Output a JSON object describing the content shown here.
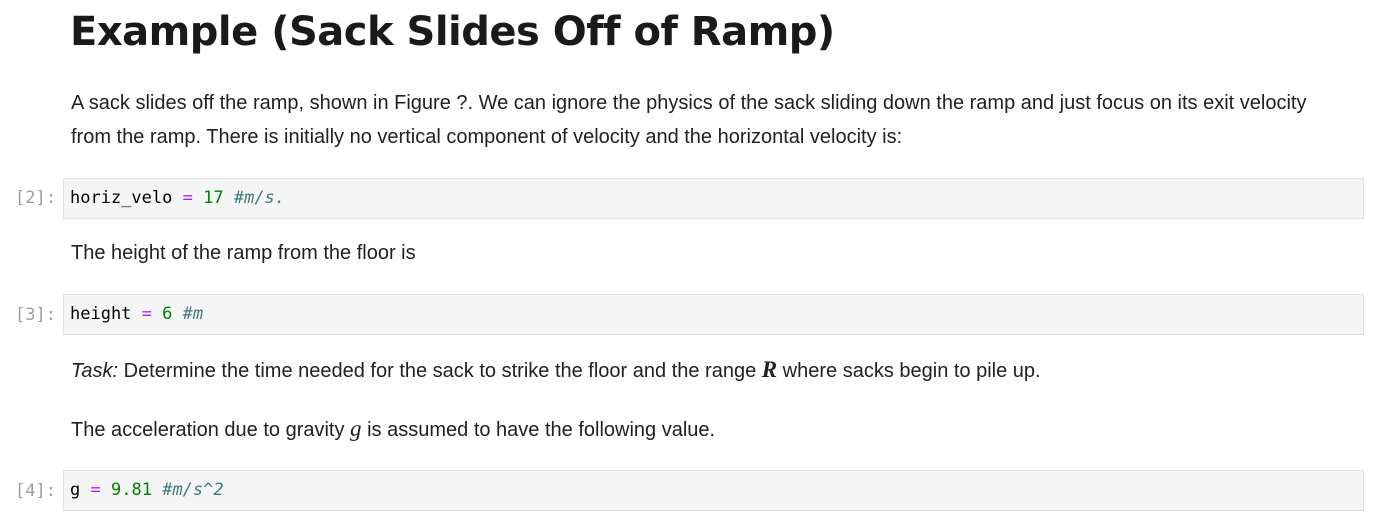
{
  "heading": "Example (Sack Slides Off of Ramp)",
  "intro": {
    "text": "A sack slides off the ramp, shown in Figure ?. We can ignore the physics of the sack sliding down the ramp and just focus on its exit velocity from the ramp. There is initially no vertical component of velocity and the horizontal velocity is:"
  },
  "cells": [
    {
      "prompt": "[2]:",
      "var": "horiz_velo",
      "op": "=",
      "value": "17",
      "comment": "#m/s."
    },
    {
      "prompt": "[3]:",
      "var": "height",
      "op": "=",
      "value": "6",
      "comment": "#m"
    },
    {
      "prompt": "[4]:",
      "var": "g",
      "op": "=",
      "value": "9.81",
      "comment": "#m/s^2"
    }
  ],
  "height_text": "The height of the ramp from the floor is",
  "task": {
    "label": "Task:",
    "before": " Determine the time needed for the sack to strike the floor and the range ",
    "symbol": "R",
    "after": " where sacks begin to pile up."
  },
  "gravity": {
    "before": "The acceleration due to gravity ",
    "symbol": "g",
    "after": " is assumed to have the following value."
  },
  "colors": {
    "operator": "#aa22ff",
    "number": "#008000",
    "comment": "#3d7b7b",
    "prompt": "#9e9e9e",
    "cell_background": "#f5f5f5"
  }
}
